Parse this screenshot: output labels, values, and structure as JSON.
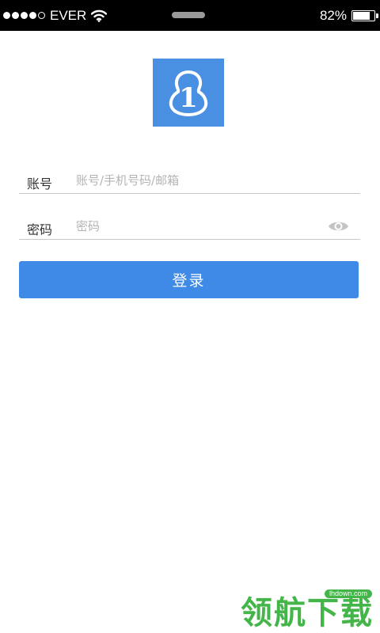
{
  "status_bar": {
    "carrier": "EVER",
    "battery_text": "82%",
    "battery_level": 0.82,
    "signal_bars_filled": 4,
    "signal_bars_total": 5
  },
  "logo": {
    "glyph": "1",
    "color": "#4a90e2",
    "icon": "gourd-logo-icon"
  },
  "form": {
    "account": {
      "label": "账号",
      "placeholder": "账号/手机号码/邮箱",
      "value": ""
    },
    "password": {
      "label": "密码",
      "placeholder": "密码",
      "value": "",
      "toggle_icon": "eye-icon"
    }
  },
  "login_button": {
    "label": "登录",
    "color": "#3f8ae6"
  },
  "watermark": {
    "url": "lhdown.com",
    "text": "领航下载",
    "color": "#44b549"
  }
}
